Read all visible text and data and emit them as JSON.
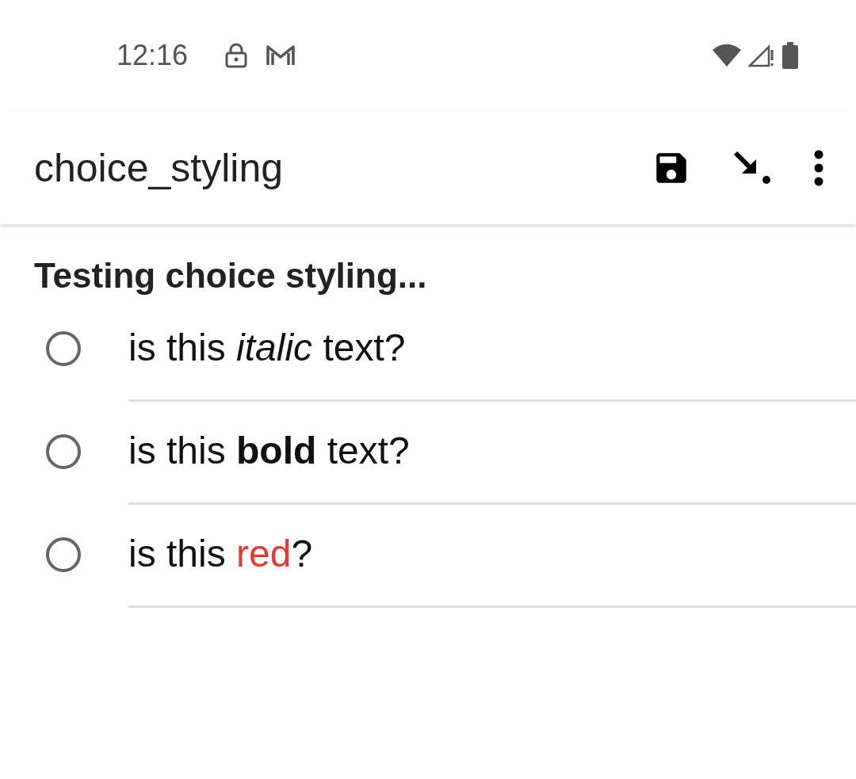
{
  "status_bar": {
    "time": "12:16"
  },
  "app_bar": {
    "title": "choice_styling"
  },
  "question": {
    "label": "Testing choice styling...",
    "options": [
      {
        "selected": false,
        "segments": [
          {
            "text": "is this "
          },
          {
            "text": "italic",
            "kind": "italic"
          },
          {
            "text": " text?"
          }
        ]
      },
      {
        "selected": false,
        "segments": [
          {
            "text": "is this "
          },
          {
            "text": "bold",
            "kind": "bold"
          },
          {
            "text": " text?"
          }
        ]
      },
      {
        "selected": false,
        "segments": [
          {
            "text": "is this "
          },
          {
            "text": "red",
            "kind": "colored",
            "color": "#e53935"
          },
          {
            "text": "?"
          }
        ]
      }
    ]
  }
}
